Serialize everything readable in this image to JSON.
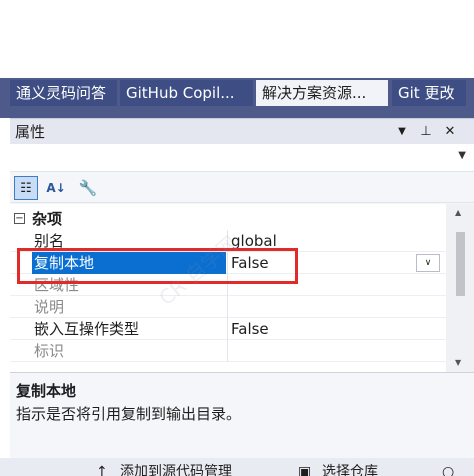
{
  "tabs": [
    {
      "label": "通义灵码问答",
      "active": false
    },
    {
      "label": "GitHub Copil...",
      "active": false
    },
    {
      "label": "解决方案资源...",
      "active": true
    },
    {
      "label": "Git 更改",
      "active": false
    }
  ],
  "panel": {
    "title": "属性",
    "header_icons": {
      "dropdown": "chevron-down-icon",
      "pin": "pin-icon",
      "close": "close-icon"
    }
  },
  "toolbar": {
    "categorized_icon": "categorized-icon",
    "alphabetical_icon": "sort-az-icon",
    "property_pages_icon": "wrench-icon"
  },
  "grid": {
    "category": {
      "label": "杂项",
      "expanded": true,
      "toggle": "⊟"
    },
    "rows": [
      {
        "name": "别名",
        "value": "global"
      },
      {
        "name": "复制本地",
        "value": "False",
        "selected": true,
        "has_dropdown": true
      },
      {
        "name": "区域性",
        "value": "",
        "disabled": true
      },
      {
        "name": "说明",
        "value": "",
        "disabled": true
      },
      {
        "name": "嵌入互操作类型",
        "value": "False"
      },
      {
        "name": "标识",
        "value": "",
        "disabled": true
      }
    ]
  },
  "description": {
    "title": "复制本地",
    "text": "指示是否将引用复制到输出目录。"
  },
  "bottom_bar": {
    "left_label": "添加到源代码管理",
    "right_label": "选择仓库"
  },
  "watermark": "CR 自学网",
  "colors": {
    "tab_strip": "#4d5a8a",
    "selection": "#0a6fd1",
    "highlight_box": "#e02b2b"
  }
}
